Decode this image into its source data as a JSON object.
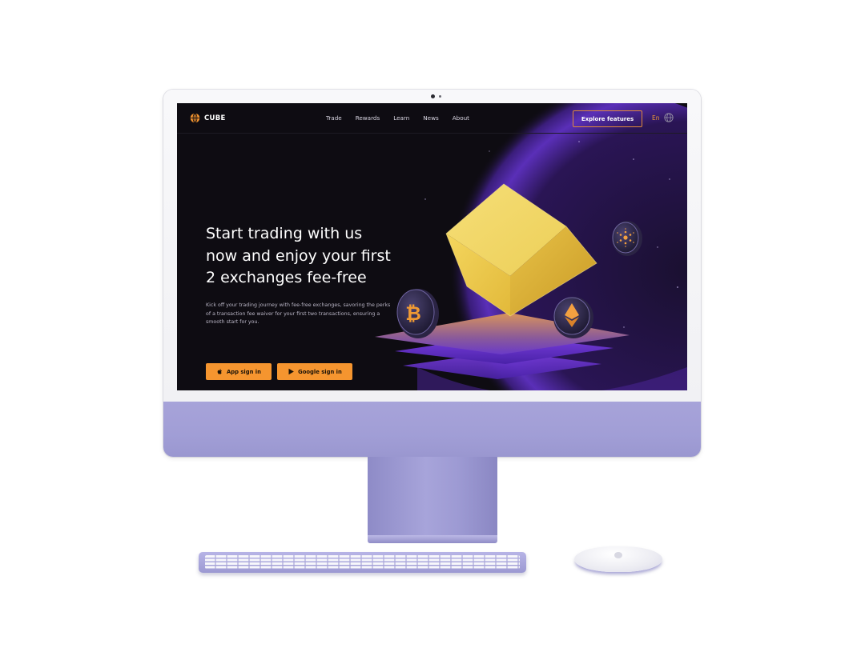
{
  "site": {
    "logo_text": "CUBE",
    "logo_icon": "globe-icon",
    "nav": {
      "items": [
        {
          "label": "Trade"
        },
        {
          "label": "Rewards"
        },
        {
          "label": "Learn"
        },
        {
          "label": "News"
        },
        {
          "label": "About"
        }
      ],
      "explore_button": "Explore features",
      "language": "En",
      "language_icon": "globe-icon"
    },
    "hero": {
      "title": "Start  trading with us\nnow and enjoy your first\n2 exchanges fee-free",
      "subtitle": "Kick off your trading journey with fee-free exchanges, savoring the perks of a transaction fee waiver for your first two transactions, ensuring a smooth start for you.",
      "buttons": {
        "app_sign_in": "App sign in",
        "app_icon": "apple-icon",
        "google_sign_in": "Google sign in",
        "google_icon": "google-play-icon"
      }
    },
    "illustration": {
      "coins": [
        "bitcoin-coin",
        "ethereum-coin",
        "cardano-coin"
      ],
      "coin_glyph_bitcoin": "₿"
    }
  },
  "colors": {
    "accent": "#f5952f",
    "screen_background": "#0e0c12",
    "cube": "#f2cc4e",
    "purple_glow": "#6a3fd0",
    "device_purple": "#a19ed6"
  }
}
